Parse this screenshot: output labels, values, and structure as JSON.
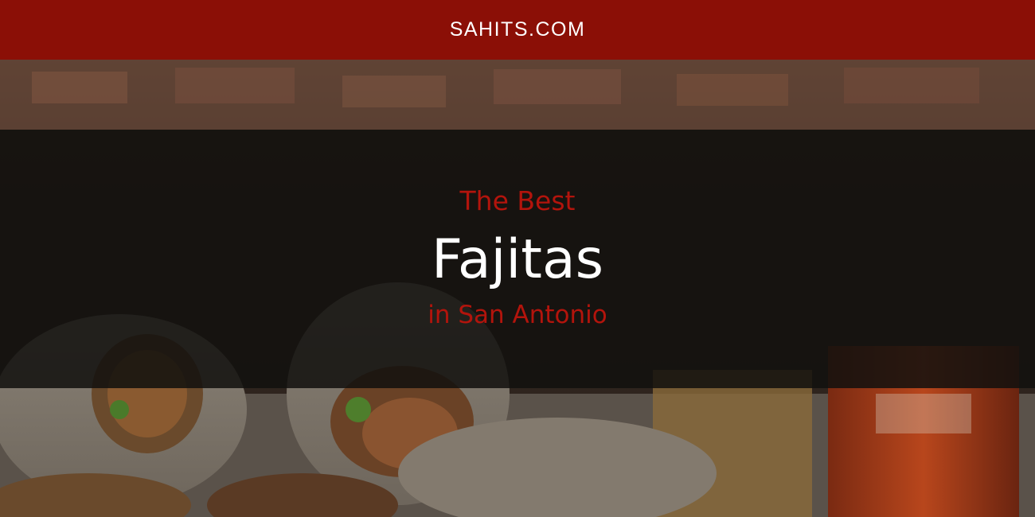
{
  "header": {
    "site_name": "SAHITS.COM"
  },
  "hero": {
    "kicker": "The Best",
    "title": "Fajitas",
    "location": "in San Antonio"
  },
  "colors": {
    "header_bg": "#8b0f06",
    "accent_red": "#b3140c",
    "title_white": "#ffffff",
    "band_dark": "#12100e"
  }
}
